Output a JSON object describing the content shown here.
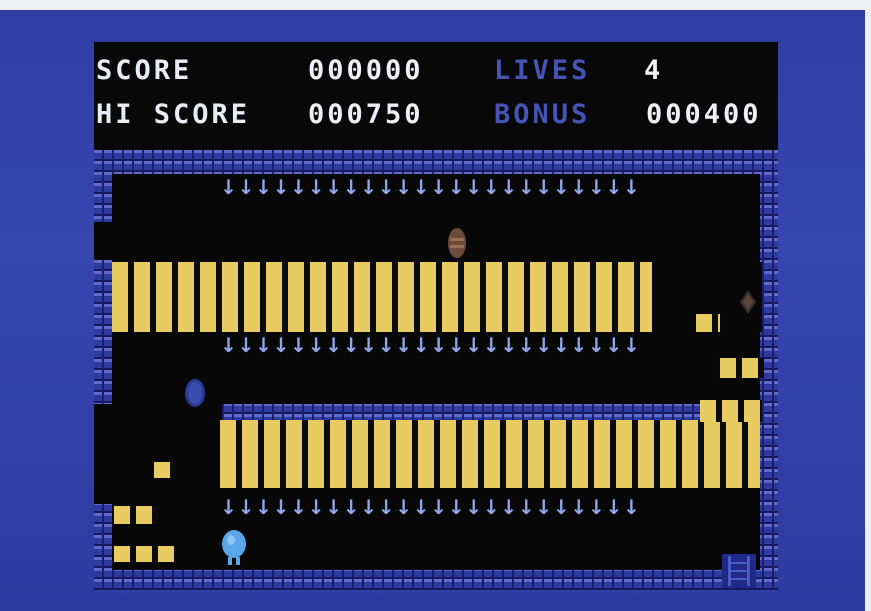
{
  "hud": {
    "score_label": "SCORE",
    "score_value": "000000",
    "lives_label": "LIVES",
    "lives_value": "4",
    "hiscore_label": "HI SCORE",
    "hiscore_value": "000750",
    "bonus_label": "BONUS",
    "bonus_value": "000400"
  },
  "colors": {
    "background_blue": "#2f3fa6",
    "hud_black": "#080808",
    "gold_brick": "#e7c85a",
    "arrow_blue": "#8fa6e8",
    "player_blue": "#5aa6e8"
  },
  "playfield": {
    "spike_rows": [
      {
        "count": 24,
        "glyph": "↓"
      },
      {
        "count": 24,
        "glyph": "↓"
      },
      {
        "count": 24,
        "glyph": "↓"
      }
    ],
    "sprites": [
      "player-icon",
      "enemy-icon",
      "egg-icon",
      "diamond-icon",
      "exit-ladder-icon"
    ]
  }
}
